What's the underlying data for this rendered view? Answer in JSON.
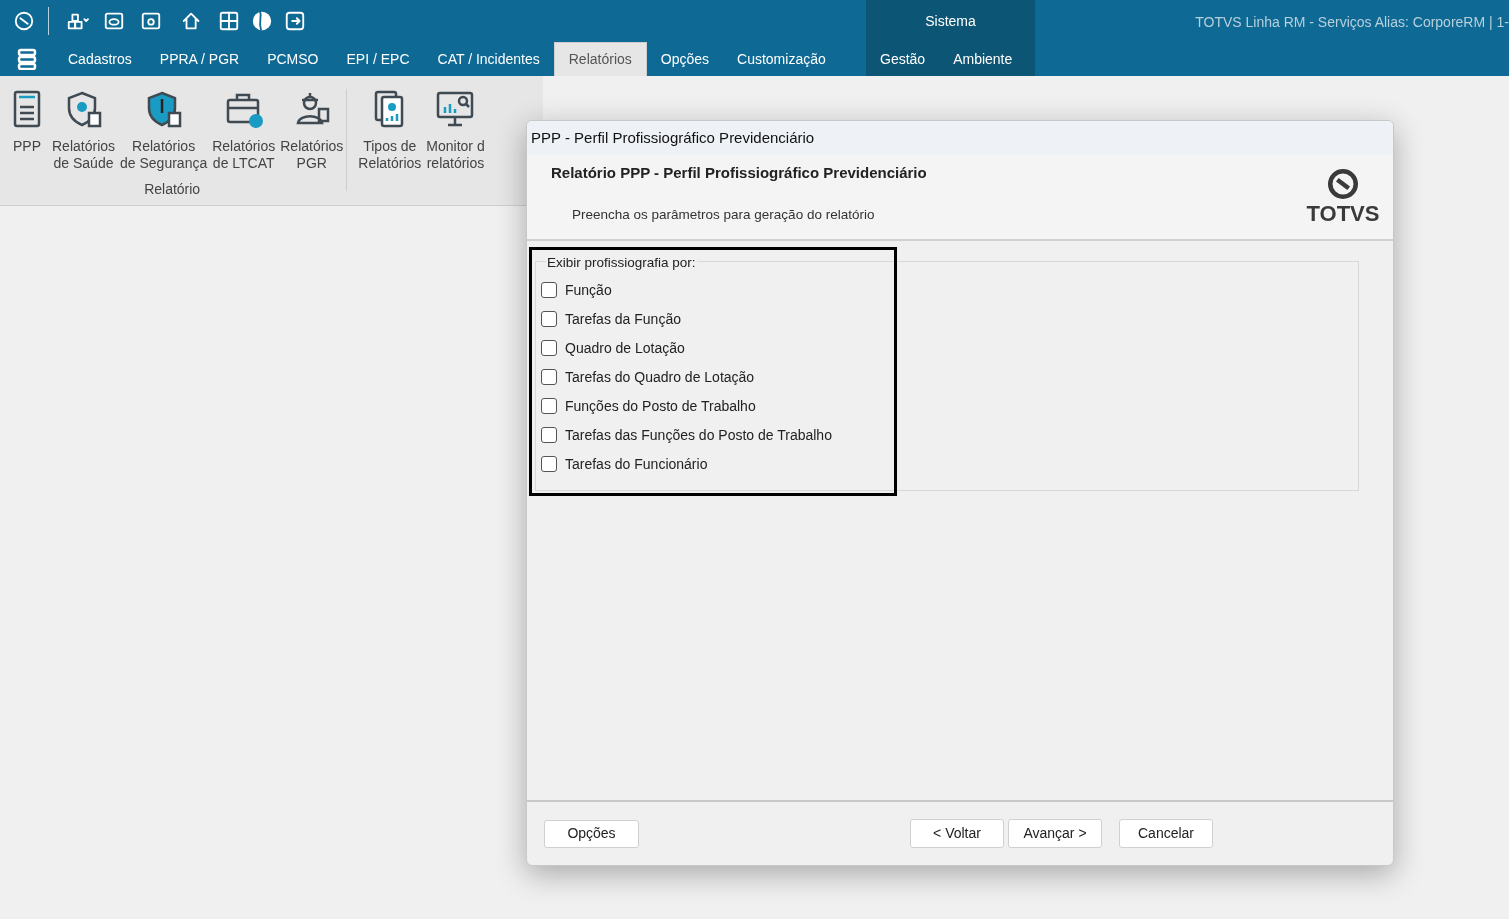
{
  "app_header": {
    "module": "Sistema",
    "context": "TOTVS Linha RM - Serviços  Alias: CorporeRM | 1-"
  },
  "menu_tabs": [
    {
      "label": "Cadastros",
      "selected": false,
      "kind": "main"
    },
    {
      "label": "PPRA / PGR",
      "selected": false,
      "kind": "main"
    },
    {
      "label": "PCMSO",
      "selected": false,
      "kind": "main"
    },
    {
      "label": "EPI / EPC",
      "selected": false,
      "kind": "main"
    },
    {
      "label": "CAT / Incidentes",
      "selected": false,
      "kind": "main"
    },
    {
      "label": "Relatórios",
      "selected": true,
      "kind": "main"
    },
    {
      "label": "Opções",
      "selected": false,
      "kind": "main"
    },
    {
      "label": "Customização",
      "selected": false,
      "kind": "main"
    },
    {
      "label": "Gestão",
      "selected": false,
      "kind": "system"
    },
    {
      "label": "Ambiente",
      "selected": false,
      "kind": "system"
    }
  ],
  "ribbon": {
    "groups": [
      {
        "label": "Relatório",
        "items": [
          {
            "kind": "ppp",
            "lines": [
              "PPP"
            ]
          },
          {
            "kind": "health",
            "lines": [
              "Relatórios",
              "de Saúde"
            ]
          },
          {
            "kind": "safety",
            "lines": [
              "Relatórios",
              "de Segurança"
            ]
          },
          {
            "kind": "ltcat",
            "lines": [
              "Relatórios",
              "de LTCAT"
            ]
          },
          {
            "kind": "pgr",
            "lines": [
              "Relatórios",
              "PGR"
            ]
          }
        ]
      },
      {
        "items": [
          {
            "kind": "types",
            "lines": [
              "Tipos de",
              "Relatórios"
            ]
          },
          {
            "kind": "monitor",
            "lines": [
              "Monitor d",
              "relatórios"
            ]
          }
        ]
      }
    ]
  },
  "dialog": {
    "title": "PPP - Perfil Profissiográfico Previdenciário",
    "heading": "Relatório PPP - Perfil Profissiográfico Previdenciário",
    "subtitle": "Preencha os parâmetros para geração do relatório",
    "logo_text": "TOTVS",
    "group": {
      "legend": "Exibir profissiografia por:",
      "highlighted": true,
      "options": [
        {
          "label": "Função",
          "checked": false
        },
        {
          "label": "Tarefas da Função",
          "checked": false
        },
        {
          "label": "Quadro de Lotação",
          "checked": false
        },
        {
          "label": "Tarefas do Quadro de Lotação",
          "checked": false
        },
        {
          "label": "Funções do Posto de Trabalho",
          "checked": false
        },
        {
          "label": "Tarefas das Funções do Posto de Trabalho",
          "checked": false
        },
        {
          "label": "Tarefas do Funcionário",
          "checked": false
        }
      ]
    },
    "left_buttons": [
      "Opções"
    ],
    "right_buttons": [
      "< Voltar",
      "Avançar >",
      "Cancelar"
    ]
  }
}
